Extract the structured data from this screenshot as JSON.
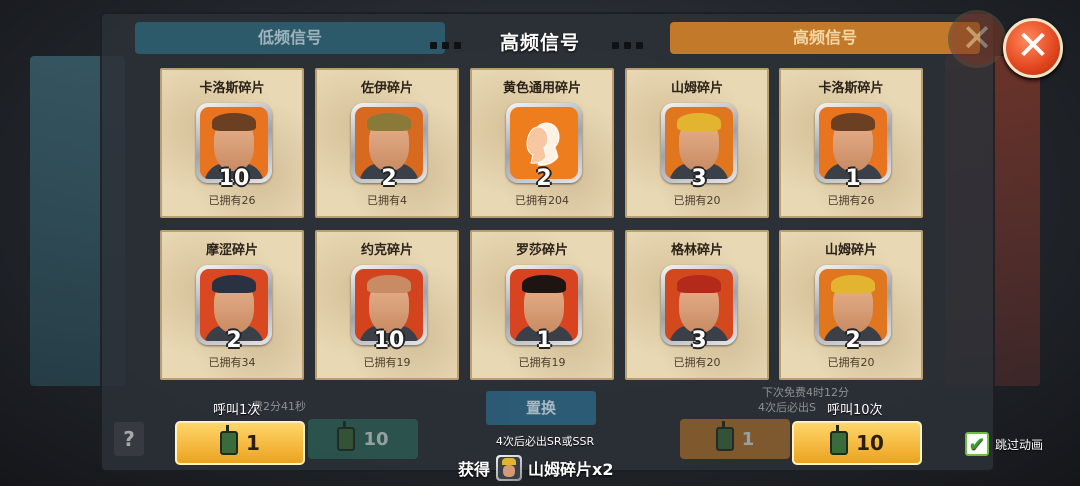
{
  "header": {
    "title": "高频信号",
    "tab_left": "低频信号",
    "tab_right": "高频信号"
  },
  "cards": [
    {
      "name": "卡洛斯碎片",
      "count": "10",
      "owned": "已拥有26",
      "portrait": "carlos",
      "bg": "#e9741f",
      "hair": "#6a3f22"
    },
    {
      "name": "佐伊碎片",
      "count": "2",
      "owned": "已拥有4",
      "portrait": "zoe",
      "bg": "#d86a20",
      "hair": "#8a7a3a"
    },
    {
      "name": "黄色通用碎片",
      "count": "2",
      "owned": "已拥有204",
      "portrait": "generic-yellow",
      "bg": "#ee7d1e",
      "hair": "#ee7d1e"
    },
    {
      "name": "山姆碎片",
      "count": "3",
      "owned": "已拥有20",
      "portrait": "sam",
      "bg": "#e0761d",
      "hair": "#e2b430"
    },
    {
      "name": "卡洛斯碎片",
      "count": "1",
      "owned": "已拥有26",
      "portrait": "carlos",
      "bg": "#e9741f",
      "hair": "#6a3f22"
    },
    {
      "name": "摩涩碎片",
      "count": "2",
      "owned": "已拥有34",
      "portrait": "morse",
      "bg": "#d94820",
      "hair": "#2a3242"
    },
    {
      "name": "约克碎片",
      "count": "10",
      "owned": "已拥有19",
      "portrait": "york",
      "bg": "#d2431e",
      "hair": "#c98b63"
    },
    {
      "name": "罗莎碎片",
      "count": "1",
      "owned": "已拥有19",
      "portrait": "rosa",
      "bg": "#d84320",
      "hair": "#1e1412"
    },
    {
      "name": "格林碎片",
      "count": "3",
      "owned": "已拥有20",
      "portrait": "green",
      "bg": "#d4481e",
      "hair": "#b42a1a"
    },
    {
      "name": "山姆碎片",
      "count": "2",
      "owned": "已拥有20",
      "portrait": "sam",
      "bg": "#e0761d",
      "hair": "#e2b430"
    }
  ],
  "bottom": {
    "call_once_label": "呼叫1次",
    "call_once_cost": "1",
    "call_ten_label": "呼叫10次",
    "call_ten_cost": "10",
    "ghost_left_cost": "10",
    "ghost_right_cost": "1",
    "replace_label": "置换",
    "help_label": "?",
    "faded_left_timer": "费2分41秒",
    "faded_right_line1": "下次免费4时12分",
    "faded_right_line2": "4次后必出S",
    "guarantee_text": "4次后必出SR或SSR",
    "obtain_prefix": "获得",
    "obtain_item": "山姆碎片x2",
    "skip_label": "跳过动画",
    "skip_checked": "✔"
  },
  "close_icon": "✕",
  "accent_colors": {
    "orange_button": "#eca31e",
    "close_red": "#e2451e"
  }
}
